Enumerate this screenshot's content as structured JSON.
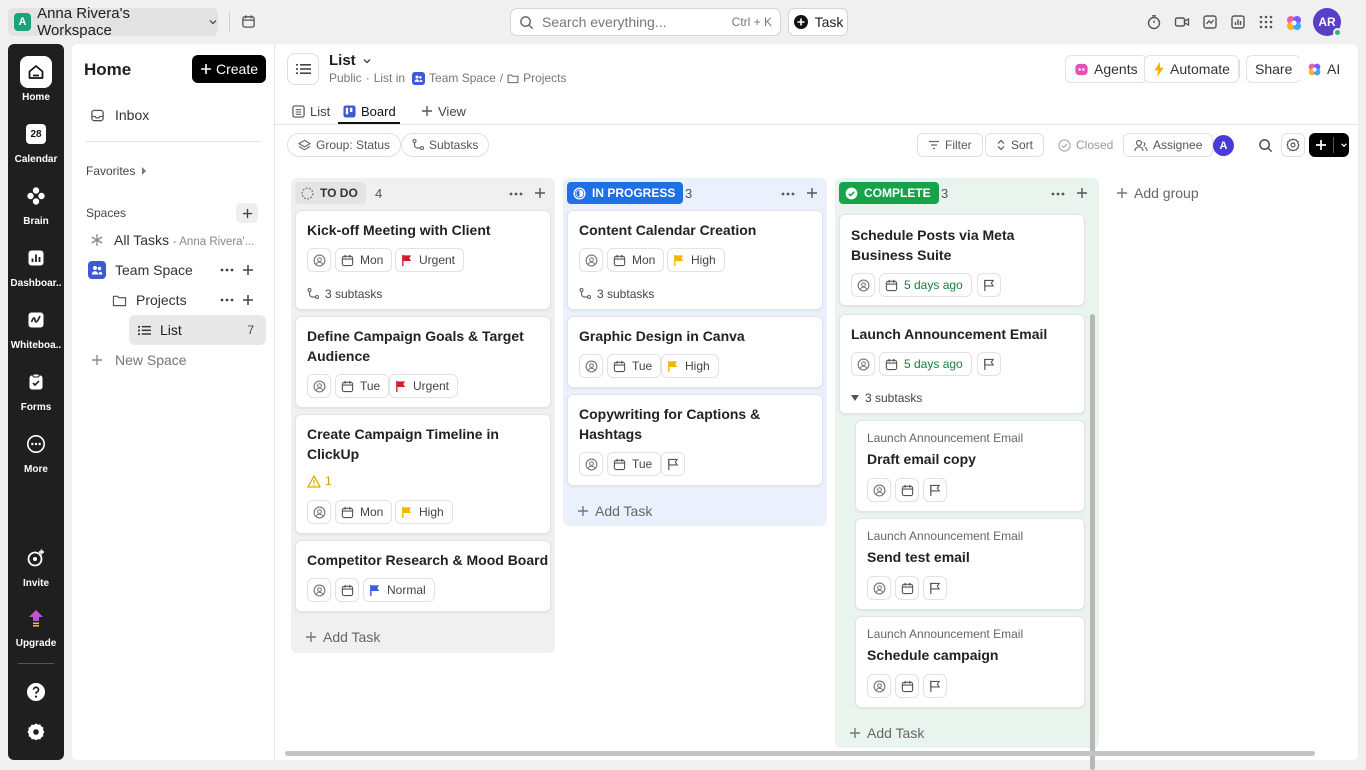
{
  "workspace": {
    "initial": "A",
    "name": "Anna Rivera's Workspace"
  },
  "search": {
    "placeholder": "Search everything...",
    "shortcut": "Ctrl + K"
  },
  "topbar": {
    "task_label": "Task",
    "avatar_initials": "AR"
  },
  "rail": {
    "items": [
      {
        "label": "Home",
        "icon": "home-icon"
      },
      {
        "label": "Calendar",
        "icon": "calendar-icon",
        "badge": "28"
      },
      {
        "label": "Brain",
        "icon": "brain-icon"
      },
      {
        "label": "Dashboar..",
        "icon": "dashboard-icon"
      },
      {
        "label": "Whiteboa..",
        "icon": "whiteboard-icon"
      },
      {
        "label": "Forms",
        "icon": "forms-icon"
      },
      {
        "label": "More",
        "icon": "more-icon"
      }
    ],
    "bottom": [
      {
        "label": "Invite",
        "icon": "invite-icon"
      },
      {
        "label": "Upgrade",
        "icon": "upgrade-icon"
      }
    ]
  },
  "sidebar": {
    "title": "Home",
    "create_label": "Create",
    "inbox": "Inbox",
    "favorites": "Favorites",
    "spaces": "Spaces",
    "all_tasks": "All Tasks",
    "all_tasks_owner": "- Anna Rivera'...",
    "team_space": "Team Space",
    "projects": "Projects",
    "list": "List",
    "list_count": "7",
    "new_space": "New Space"
  },
  "header": {
    "title": "List",
    "visibility": "Public",
    "list_in": "List in",
    "crumb_space": "Team Space",
    "crumb_sep": "/",
    "crumb_folder": "Projects",
    "agents": "Agents",
    "automate": "Automate",
    "share": "Share",
    "ai": "AI"
  },
  "view_tabs": {
    "list": "List",
    "board": "Board",
    "add_view": "View"
  },
  "toolbar": {
    "group": "Group: Status",
    "subtasks": "Subtasks",
    "filter": "Filter",
    "sort": "Sort",
    "closed": "Closed",
    "assignee": "Assignee",
    "assignee_initial": "A"
  },
  "board": {
    "add_group": "Add group",
    "add_task": "Add Task",
    "columns": [
      {
        "status": "TO DO",
        "count": "4",
        "color": "#e6e6e6",
        "cards": [
          {
            "title": "Kick-off Meeting with Client",
            "day": "Mon",
            "priority": "Urgent",
            "subtasks": "3 subtasks"
          },
          {
            "title": "Define Campaign Goals & Target Audience",
            "day": "Tue",
            "priority": "Urgent"
          },
          {
            "title": "Create Campaign Timeline in ClickUp",
            "warning": "1",
            "day": "Mon",
            "priority": "High"
          },
          {
            "title": "Competitor Research & Mood Board",
            "priority": "Normal"
          }
        ]
      },
      {
        "status": "IN PROGRESS",
        "count": "3",
        "color": "#1f6fe5",
        "cards": [
          {
            "title": "Content Calendar Creation",
            "day": "Mon",
            "priority": "High",
            "subtasks": "3 subtasks"
          },
          {
            "title": "Graphic Design in Canva",
            "day": "Tue",
            "priority": "High"
          },
          {
            "title": "Copywriting for Captions & Hashtags",
            "day": "Tue"
          }
        ]
      },
      {
        "status": "COMPLETE",
        "count": "3",
        "color": "#17a34a",
        "cards": [
          {
            "title": "Schedule Posts via Meta Business Suite",
            "date": "5 days ago"
          },
          {
            "title": "Launch Announcement Email",
            "date": "5 days ago",
            "subtasks": "3 subtasks"
          }
        ],
        "subcards": [
          {
            "parent": "Launch Announcement Email",
            "title": "Draft email copy"
          },
          {
            "parent": "Launch Announcement Email",
            "title": "Send test email"
          },
          {
            "parent": "Launch Announcement Email",
            "title": "Schedule campaign"
          }
        ]
      }
    ]
  },
  "colors": {
    "urgent": "#d0202b",
    "high": "#f5b400",
    "normal": "#3a5bd9",
    "complete_date": "#17803d"
  }
}
